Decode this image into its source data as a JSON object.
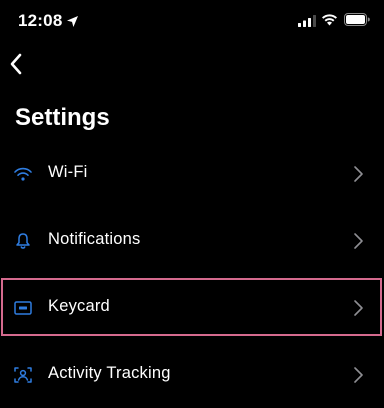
{
  "status_bar": {
    "time": "12:08",
    "location_icon": "location-arrow-icon",
    "signal_icon": "cellular-signal-icon",
    "wifi_icon": "wifi-status-icon",
    "battery_icon": "battery-icon"
  },
  "nav": {
    "back_icon": "chevron-left-icon"
  },
  "header": {
    "title": "Settings"
  },
  "settings_rows": [
    {
      "label": "Wi-Fi",
      "icon": "wifi-icon"
    },
    {
      "label": "Notifications",
      "icon": "bell-icon"
    },
    {
      "label": "Keycard",
      "icon": "keycard-icon"
    },
    {
      "label": "Activity Tracking",
      "icon": "activity-tracking-icon"
    }
  ],
  "colors": {
    "background": "#000000",
    "text": "#ffffff",
    "icon_accent": "#2f7de1",
    "chevron": "#8e8e93",
    "highlight": "#d46a8e"
  }
}
